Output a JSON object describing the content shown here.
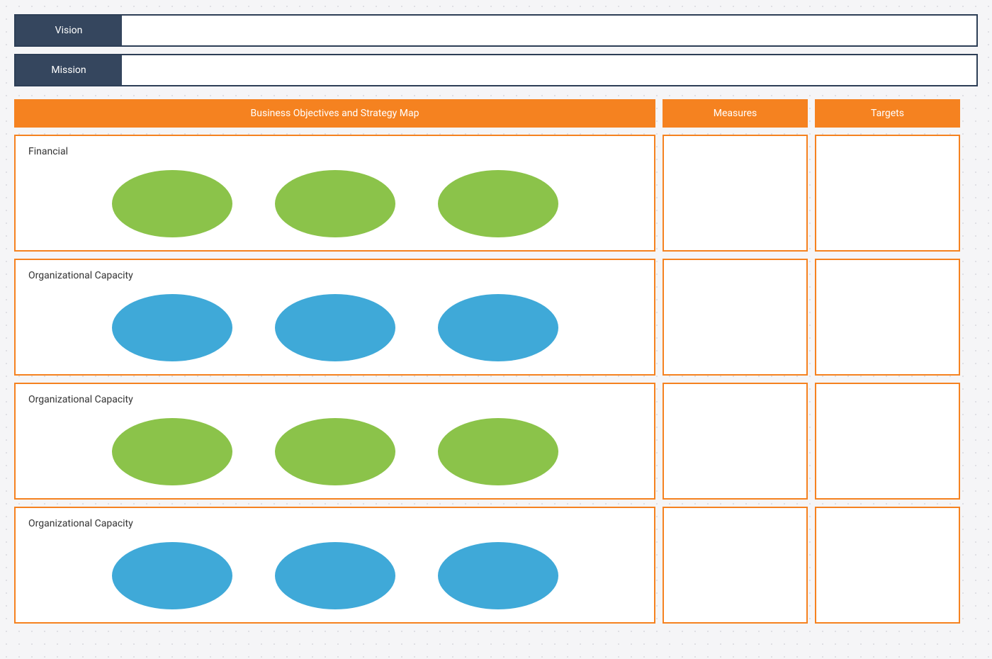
{
  "vision_mission": {
    "vision_label": "Vision",
    "mission_label": "Mission"
  },
  "headers": {
    "objectives": "Business Objectives and Strategy Map",
    "measures": "Measures",
    "targets": "Targets"
  },
  "rows": [
    {
      "label": "Financial",
      "ellipse_color": "green"
    },
    {
      "label": "Organizational Capacity",
      "ellipse_color": "blue"
    },
    {
      "label": "Organizational Capacity",
      "ellipse_color": "green"
    },
    {
      "label": "Organizational Capacity",
      "ellipse_color": "blue"
    }
  ],
  "colors": {
    "orange": "#f58220",
    "navy": "#35465e",
    "green": "#8bc34a",
    "blue": "#3fa9d8"
  }
}
